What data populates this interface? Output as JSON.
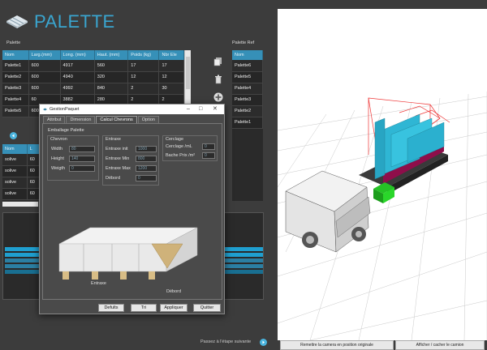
{
  "app": {
    "title": "PALETTE",
    "accent": "#3aa5cf"
  },
  "palette_section": {
    "label": "Palette"
  },
  "palette_ref_section": {
    "label": "Palette Ref"
  },
  "palette_table": {
    "columns": [
      "Nom",
      "Larg.(mm)",
      "Long. (mm)",
      "Haut. (mm)",
      "Poids (kg)",
      "Nbr Ele"
    ],
    "rows": [
      [
        "Palette1",
        "600",
        "4917",
        "560",
        "17",
        "17"
      ],
      [
        "Palette2",
        "600",
        "4940",
        "320",
        "12",
        "12"
      ],
      [
        "Palette3",
        "600",
        "4992",
        "840",
        "2",
        "30"
      ],
      [
        "Palette4",
        "60",
        "3882",
        "280",
        "2",
        "2"
      ],
      [
        "Palette5",
        "600",
        "",
        "",
        "",
        ""
      ]
    ]
  },
  "palette_ref_table": {
    "column": "Nom",
    "rows": [
      "Palette6",
      "Palette5",
      "Palette4",
      "Palette3",
      "Palette2",
      "Palette1"
    ]
  },
  "lower_table": {
    "columns": [
      "Nom",
      "L"
    ],
    "rows": [
      [
        "solive",
        "60"
      ],
      [
        "solive",
        "60"
      ],
      [
        "solive",
        "60"
      ],
      [
        "solive",
        "60"
      ]
    ]
  },
  "dialog": {
    "title": "GestionPaquet",
    "tabs": [
      "Attribut",
      "Dimension",
      "Calcul Chevrons",
      "Option"
    ],
    "section_title": "Emballage Palette",
    "chevron": {
      "title": "Chevron",
      "width_label": "Width",
      "width_value": "80",
      "height_label": "Height",
      "height_value": "140",
      "weight_label": "Weigth",
      "weight_value": "0"
    },
    "entraxe": {
      "title": "Entraxe",
      "init_label": "Entraxe init",
      "init_value": "1000",
      "min_label": "Entraxe Min",
      "min_value": "800",
      "max_label": "Entraxe Max",
      "max_value": "1200",
      "debord_label": "Débord",
      "debord_value": "0"
    },
    "cerclage": {
      "title": "Cerclage",
      "ml_label": "Cerclage /mL",
      "ml_value": "0",
      "bache_label": "Bache Prix /m²",
      "bache_value": "0"
    },
    "image_labels": {
      "entraxe": "Entraxe",
      "debord": "Débord"
    },
    "buttons": {
      "defaults": "Defults",
      "tri": "Tri",
      "apply": "Appliquer",
      "quit": "Quitter"
    }
  },
  "next_step": {
    "label": "Passez à l'étape suivante"
  },
  "viewport_buttons": {
    "reset_camera": "Remettre la camera en position originale",
    "toggle_truck": "Afficher / cacher le camion"
  },
  "colors": {
    "header_blue": "#3690b8",
    "strip_blue": "#1f9fd0",
    "panel_dark": "#2a2a2a"
  }
}
